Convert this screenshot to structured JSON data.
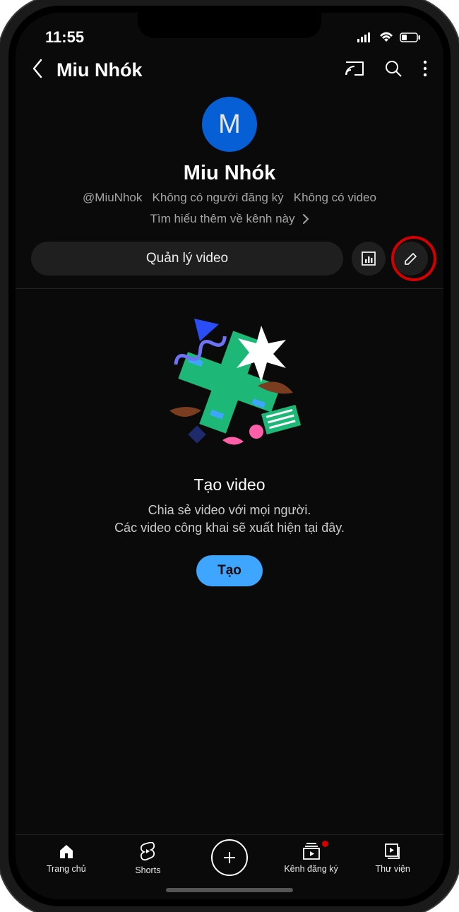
{
  "status": {
    "time": "11:55"
  },
  "header": {
    "title": "Miu Nhók"
  },
  "profile": {
    "avatar_letter": "M",
    "channel_name": "Miu Nhók",
    "handle": "@MiuNhok",
    "subs": "Không có người đăng ký",
    "videos": "Không có video",
    "learn_more": "Tìm hiểu thêm về kênh này"
  },
  "actions": {
    "manage_label": "Quản lý video"
  },
  "empty": {
    "title": "Tạo video",
    "line1": "Chia sẻ video với mọi người.",
    "line2": "Các video công khai sẽ xuất hiện tại đây.",
    "cta": "Tạo"
  },
  "nav": {
    "home": "Trang chủ",
    "shorts": "Shorts",
    "subs": "Kênh đăng ký",
    "library": "Thư viện"
  }
}
